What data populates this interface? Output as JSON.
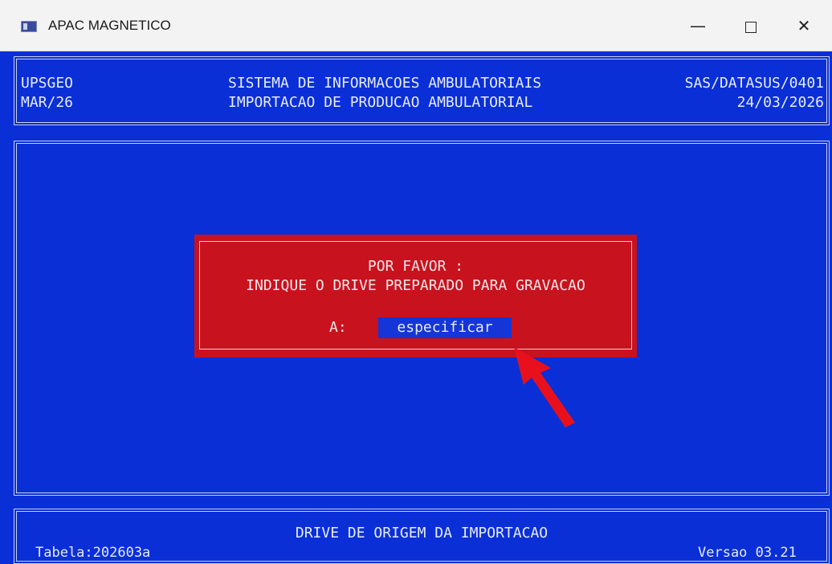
{
  "window": {
    "title": "APAC MAGNETICO",
    "minimize": "—",
    "close": "✕"
  },
  "header": {
    "left_line1": "UPSGEO",
    "left_line2": "MAR/26",
    "center_line1": "SISTEMA DE INFORMACOES AMBULATORIAIS",
    "center_line2": "IMPORTACAO DE PRODUCAO AMBULATORIAL",
    "right_line1": "SAS/DATASUS/0401",
    "right_line2": "24/03/2026"
  },
  "dialog": {
    "line1": "POR FAVOR :",
    "line2": "INDIQUE O DRIVE PREPARADO PARA GRAVACAO",
    "drive_label": "A:",
    "input_value": "especificar"
  },
  "footer": {
    "center": "DRIVE DE ORIGEM DA IMPORTACAO",
    "left_label": "Tabela:202603a",
    "right_label": "Versao 03.21"
  },
  "colors": {
    "console_bg": "#0a2fd7",
    "dialog_bg": "#c8121e",
    "arrow": "#e8101c"
  }
}
